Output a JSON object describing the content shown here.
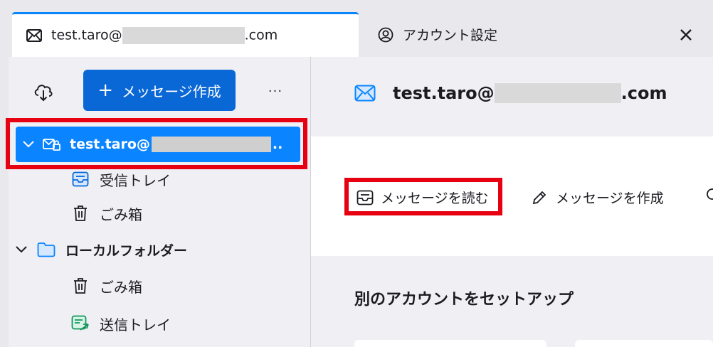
{
  "tabs": [
    {
      "icon": "envelope-icon",
      "label_prefix": "test.taro@",
      "label_suffix": ".com",
      "active": true
    },
    {
      "icon": "account-settings-icon",
      "label": "アカウント設定",
      "active": false
    }
  ],
  "close_tab": {
    "icon": "close-icon",
    "glyph": "✕"
  },
  "folder_pane": {
    "compose_plus": "+",
    "compose_label": "メッセージ作成",
    "more_label": "···",
    "account": {
      "prefix": "test.taro@",
      "suffix": ".."
    },
    "account_folders": [
      {
        "label": "受信トレイ",
        "icon": "inbox-icon"
      },
      {
        "label": "ごみ箱",
        "icon": "trash-icon"
      }
    ],
    "local_folders_label": "ローカルフォルダー",
    "local_folders": [
      {
        "label": "ごみ箱",
        "icon": "trash-icon"
      },
      {
        "label": "送信トレイ",
        "icon": "outbox-icon"
      }
    ]
  },
  "main": {
    "title_prefix": "test.taro@",
    "title_suffix": ".com",
    "actions": [
      {
        "label": "メッセージを読む",
        "icon": "inbox-icon"
      },
      {
        "label": "メッセージを作成",
        "icon": "pencil-icon"
      }
    ],
    "setup_title": "別のアカウントをセットアップ"
  },
  "colors": {
    "accent": "#0a84ff",
    "compose": "#0a67d6",
    "highlight": "#e60012"
  }
}
